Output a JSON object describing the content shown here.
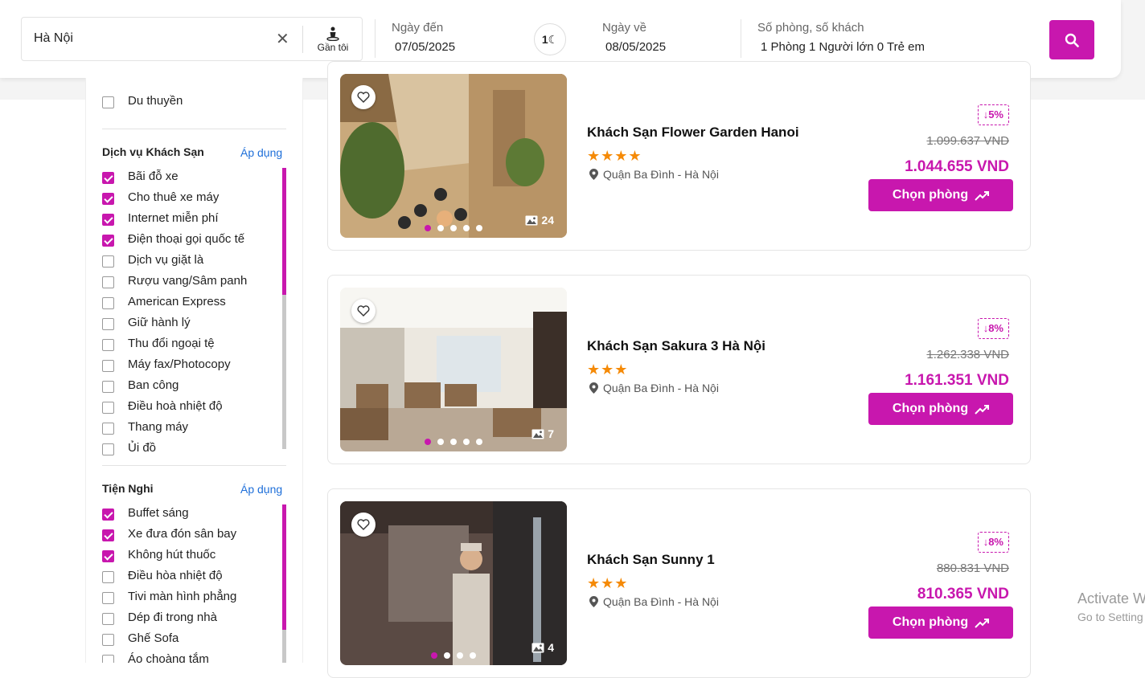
{
  "search": {
    "location_value": "Hà Nội",
    "near_me_label": "Gần tôi",
    "checkin_label": "Ngày đến",
    "checkin_value": "07/05/2025",
    "nights": "1",
    "checkout_label": "Ngày về",
    "checkout_value": "08/05/2025",
    "rooms_label": "Số phòng, số khách",
    "rooms_value": "1 Phòng 1 Người lớn 0 Trẻ em"
  },
  "sidebar": {
    "top_item": {
      "label": "Du thuyền",
      "checked": false
    },
    "services": {
      "title": "Dịch vụ Khách Sạn",
      "apply_label": "Áp dụng",
      "items": [
        {
          "label": "Bãi đỗ xe",
          "checked": true
        },
        {
          "label": "Cho thuê xe máy",
          "checked": true
        },
        {
          "label": "Internet miễn phí",
          "checked": true
        },
        {
          "label": "Điện thoại gọi quốc tế",
          "checked": true
        },
        {
          "label": "Dịch vụ giặt là",
          "checked": false
        },
        {
          "label": "Rượu vang/Sâm panh",
          "checked": false
        },
        {
          "label": "American Express",
          "checked": false
        },
        {
          "label": "Giữ hành lý",
          "checked": false
        },
        {
          "label": "Thu đổi ngoại tệ",
          "checked": false
        },
        {
          "label": "Máy fax/Photocopy",
          "checked": false
        },
        {
          "label": "Ban công",
          "checked": false
        },
        {
          "label": "Điều hoà nhiệt độ",
          "checked": false
        },
        {
          "label": "Thang máy",
          "checked": false
        },
        {
          "label": "Ủi đồ",
          "checked": false
        }
      ]
    },
    "amenities": {
      "title": "Tiện Nghi",
      "apply_label": "Áp dụng",
      "items": [
        {
          "label": "Buffet sáng",
          "checked": true
        },
        {
          "label": "Xe đưa đón sân bay",
          "checked": true
        },
        {
          "label": "Không hút thuốc",
          "checked": true
        },
        {
          "label": "Điều hòa nhiệt độ",
          "checked": false
        },
        {
          "label": "Tivi màn hình phẳng",
          "checked": false
        },
        {
          "label": "Dép đi trong nhà",
          "checked": false
        },
        {
          "label": "Ghế Sofa",
          "checked": false
        },
        {
          "label": "Áo choàng tắm",
          "checked": false
        }
      ]
    }
  },
  "hotels": [
    {
      "name": "Khách Sạn Flower Garden Hanoi",
      "stars": "★★★★",
      "address": "Quận Ba Đình - Hà Nội",
      "discount": "↓5%",
      "old_price": "1.099.637 VND",
      "new_price": "1.044.655 VND",
      "image_count": "24",
      "button_label": "Chọn phòng"
    },
    {
      "name": "Khách Sạn Sakura 3 Hà Nội",
      "stars": "★★★",
      "address": "Quận Ba Đình - Hà Nội",
      "discount": "↓8%",
      "old_price": "1.262.338 VND",
      "new_price": "1.161.351 VND",
      "image_count": "7",
      "button_label": "Chọn phòng"
    },
    {
      "name": "Khách Sạn Sunny 1",
      "stars": "★★★",
      "address": "Quận Ba Đình - Hà Nội",
      "discount": "↓8%",
      "old_price": "880.831 VND",
      "new_price": "810.365 VND",
      "image_count": "4",
      "button_label": "Chọn phòng"
    }
  ],
  "watermark": {
    "line1": "Activate W",
    "line2": "Go to Setting"
  },
  "colors": {
    "accent": "#c817ae",
    "star": "#f58a07",
    "link": "#1e6fd9"
  }
}
